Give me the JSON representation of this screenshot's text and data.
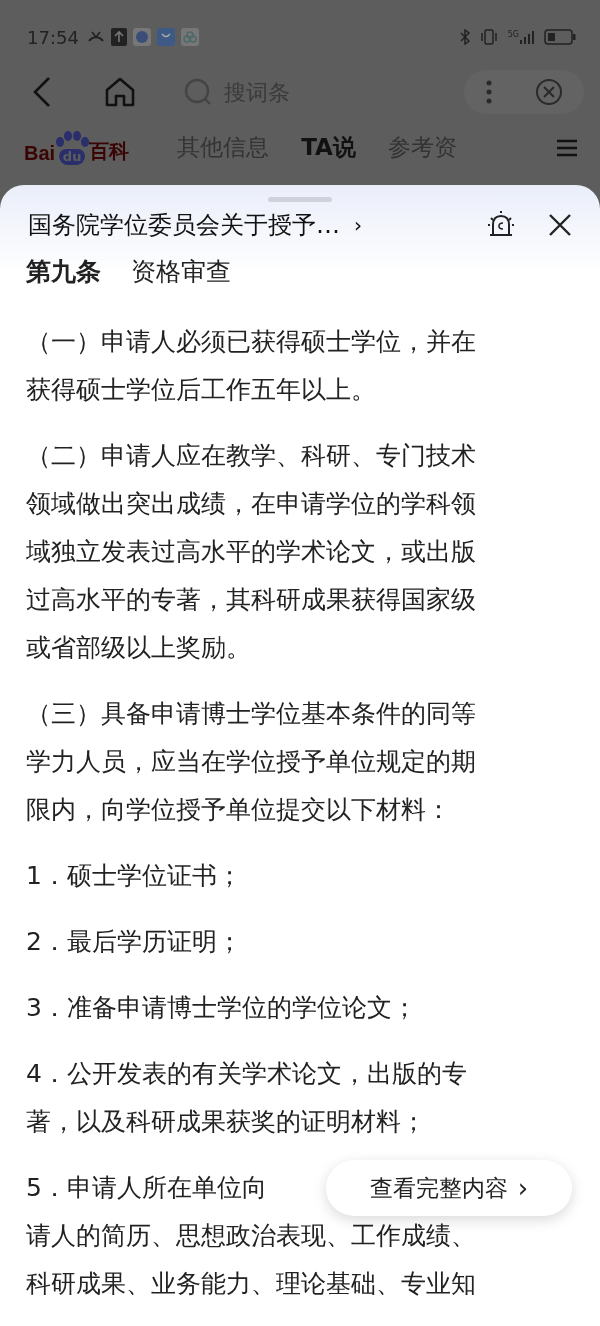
{
  "status_bar": {
    "time": "17:54",
    "network": "5G"
  },
  "nav": {
    "search": {
      "placeholder": "搜词条"
    }
  },
  "logo": {
    "left": "Bai",
    "paw": "du",
    "right": "百科"
  },
  "tabs": [
    {
      "label": "其他信息",
      "selected": false
    },
    {
      "label": "TA说",
      "selected": true
    },
    {
      "label": "参考资",
      "selected": false
    }
  ],
  "sheet": {
    "title": "国务院学位委员会关于授予…",
    "title_arrow": "›",
    "heading": {
      "number": "第九条",
      "text": "资格审查"
    },
    "paragraphs": [
      {
        "lines": [
          "（一）申请人必须已获得硕士学位，并在",
          "获得硕士学位后工作五年以上。"
        ]
      },
      {
        "lines": [
          "（二）申请人应在教学、科研、专门技术",
          "领域做出突出成绩，在申请学位的学科领",
          "域独立发表过高水平的学术论文，或出版",
          "过高水平的专著，其科研成果获得国家级",
          "或省部级以上奖励。"
        ]
      },
      {
        "lines": [
          "（三）具备申请博士学位基本条件的同等",
          "学力人员，应当在学位授予单位规定的期",
          "限内，向学位授予单位提交以下材料："
        ]
      },
      {
        "lines": [
          "1．硕士学位证书；"
        ]
      },
      {
        "lines": [
          "2．最后学历证明；"
        ]
      },
      {
        "lines": [
          "3．准备申请博士学位的学位论文；"
        ]
      },
      {
        "lines": [
          "4．公开发表的有关学术论文，出版的专",
          "著，以及科研成果获奖的证明材料；"
        ]
      },
      {
        "lines": [
          "5．申请人所在单位向",
          "请人的简历、思想政治表现、工作成绩、",
          "科研成果、业务能力、理论基础、专业知"
        ]
      }
    ],
    "more_button": {
      "label": "查看完整内容",
      "arrow": "›"
    }
  }
}
